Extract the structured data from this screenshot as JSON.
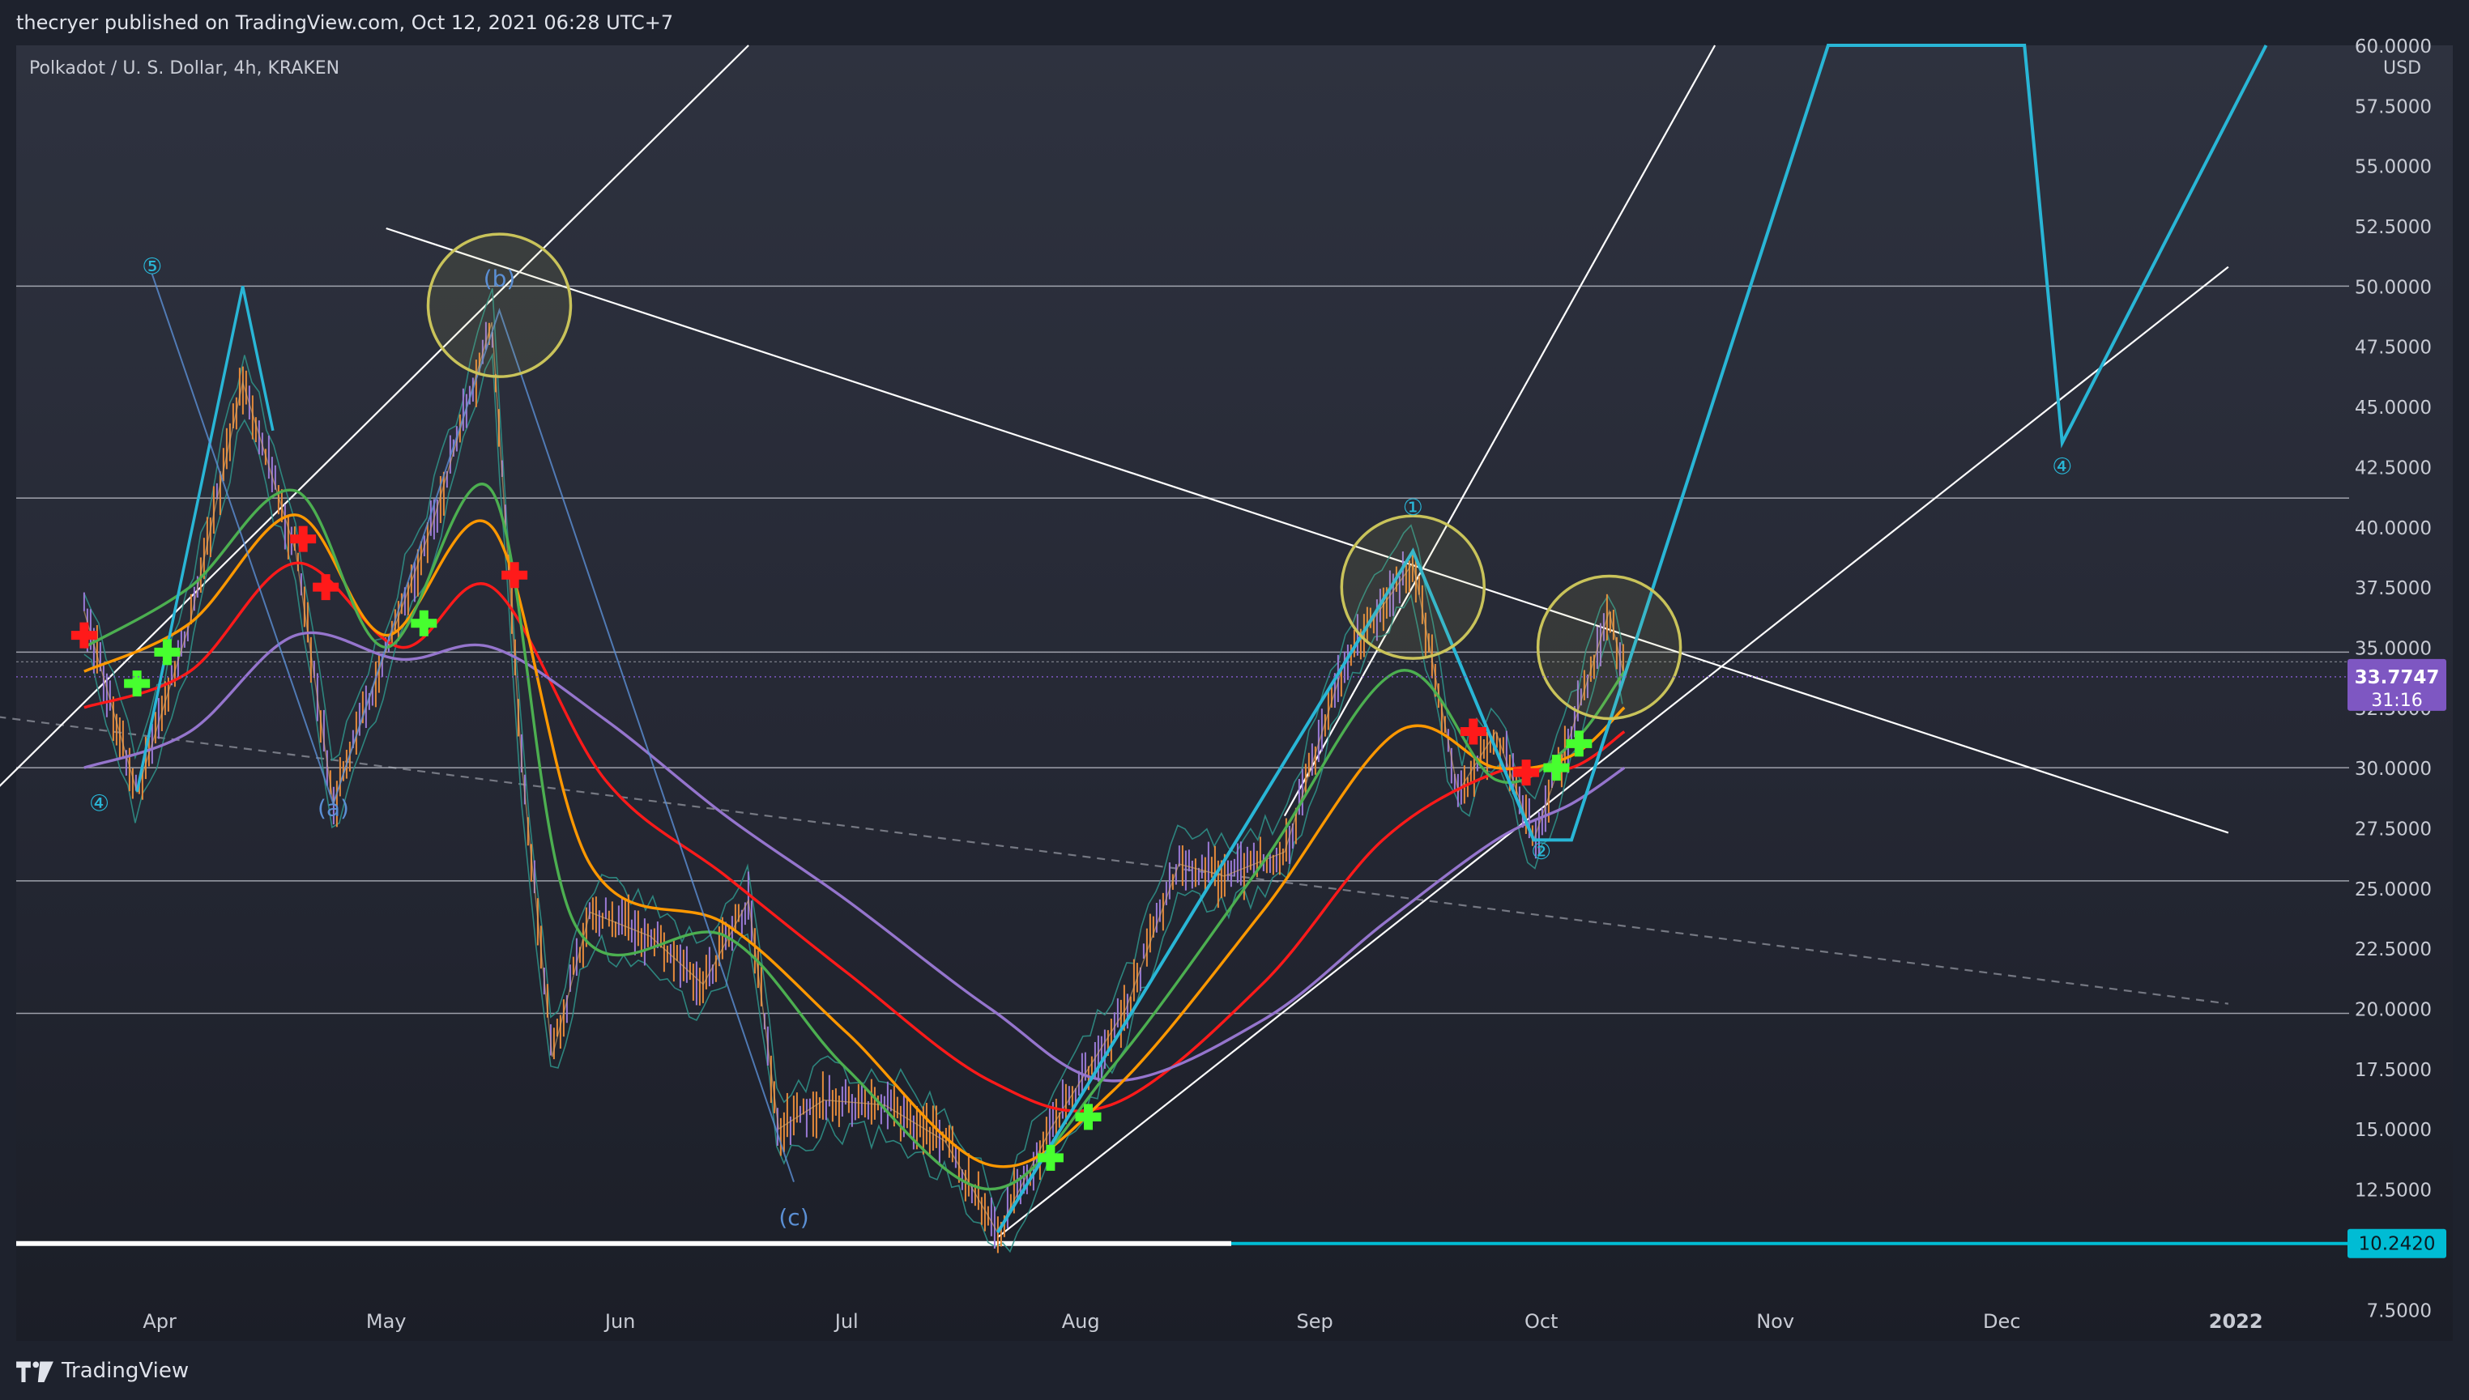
{
  "header": {
    "published": "thecryer published on TradingView.com, Oct 12, 2021 06:28 UTC+7"
  },
  "footer": {
    "brand": "TradingView",
    "logo_icon": "tradingview-logo-icon"
  },
  "colors": {
    "grid": "#c8cbd4",
    "ema_red": "#ff1a1a",
    "ema_orange": "#ff9800",
    "ema_green": "#4caf50",
    "ema_purple": "#9575cd",
    "wave_cyan": "#29b6d6",
    "circle_yellow": "#c9c35a",
    "cross_green": "#47ff2f",
    "cross_red": "#ff1a1a",
    "price_tag": "#7e57c2",
    "support_tag": "#00bcd4"
  },
  "chart_data": {
    "type": "line",
    "title": "Polkadot / U. S. Dollar, 4h, KRAKEN",
    "currency": "USD",
    "x_ticks": [
      "Apr",
      "May",
      "Jun",
      "Jul",
      "Aug",
      "Sep",
      "Oct",
      "Nov",
      "Dec",
      "2022"
    ],
    "y_ticks": [
      "60.0000",
      "57.5000",
      "55.0000",
      "52.5000",
      "50.0000",
      "47.5000",
      "45.0000",
      "42.5000",
      "40.0000",
      "37.5000",
      "35.0000",
      "32.5000",
      "30.0000",
      "27.5000",
      "25.0000",
      "22.5000",
      "20.0000",
      "17.5000",
      "15.0000",
      "12.5000",
      "7.5000"
    ],
    "ylim": [
      6.4,
      60.0
    ],
    "xlim_days_label": "Mar 2021 – Jan 2022",
    "last_price": {
      "value": "33.7747",
      "countdown": "31:16"
    },
    "support_level": {
      "value": "10.2420"
    },
    "horizontal_levels": [
      50.0,
      41.2,
      34.8,
      30.0,
      25.3,
      19.8
    ],
    "price_path": [
      {
        "x": "2021-03-22",
        "y": 36.5
      },
      {
        "x": "2021-03-29",
        "y": 29.0
      },
      {
        "x": "2021-04-05",
        "y": 36.0
      },
      {
        "x": "2021-04-12",
        "y": 46.0
      },
      {
        "x": "2021-04-19",
        "y": 39.0
      },
      {
        "x": "2021-04-24",
        "y": 28.5
      },
      {
        "x": "2021-04-30",
        "y": 34.0
      },
      {
        "x": "2021-05-07",
        "y": 40.0
      },
      {
        "x": "2021-05-15",
        "y": 48.5
      },
      {
        "x": "2021-05-19",
        "y": 30.0
      },
      {
        "x": "2021-05-23",
        "y": 18.0
      },
      {
        "x": "2021-05-28",
        "y": 24.0
      },
      {
        "x": "2021-06-05",
        "y": 23.0
      },
      {
        "x": "2021-06-12",
        "y": 21.0
      },
      {
        "x": "2021-06-18",
        "y": 24.5
      },
      {
        "x": "2021-06-22",
        "y": 15.0
      },
      {
        "x": "2021-06-28",
        "y": 16.2
      },
      {
        "x": "2021-07-06",
        "y": 16.0
      },
      {
        "x": "2021-07-14",
        "y": 14.5
      },
      {
        "x": "2021-07-21",
        "y": 10.7
      },
      {
        "x": "2021-07-28",
        "y": 15.0
      },
      {
        "x": "2021-08-07",
        "y": 20.0
      },
      {
        "x": "2021-08-14",
        "y": 26.0
      },
      {
        "x": "2021-08-20",
        "y": 25.5
      },
      {
        "x": "2021-08-28",
        "y": 26.5
      },
      {
        "x": "2021-09-05",
        "y": 34.5
      },
      {
        "x": "2021-09-14",
        "y": 38.5
      },
      {
        "x": "2021-09-20",
        "y": 29.0
      },
      {
        "x": "2021-09-25",
        "y": 31.5
      },
      {
        "x": "2021-09-30",
        "y": 27.0
      },
      {
        "x": "2021-10-05",
        "y": 31.5
      },
      {
        "x": "2021-10-10",
        "y": 36.5
      },
      {
        "x": "2021-10-12",
        "y": 33.7747
      }
    ],
    "series": [
      {
        "color_key": "ema_red",
        "values": [
          {
            "x": "2021-03-22",
            "y": 32.5
          },
          {
            "x": "2021-04-05",
            "y": 34.0
          },
          {
            "x": "2021-04-19",
            "y": 38.5
          },
          {
            "x": "2021-05-03",
            "y": 35.0
          },
          {
            "x": "2021-05-15",
            "y": 37.5
          },
          {
            "x": "2021-05-30",
            "y": 29.5
          },
          {
            "x": "2021-06-15",
            "y": 25.5
          },
          {
            "x": "2021-07-01",
            "y": 21.5
          },
          {
            "x": "2021-07-20",
            "y": 17.0
          },
          {
            "x": "2021-08-05",
            "y": 16.0
          },
          {
            "x": "2021-08-25",
            "y": 21.0
          },
          {
            "x": "2021-09-10",
            "y": 27.0
          },
          {
            "x": "2021-09-25",
            "y": 29.8
          },
          {
            "x": "2021-10-05",
            "y": 30.0
          },
          {
            "x": "2021-10-12",
            "y": 31.5
          }
        ]
      },
      {
        "color_key": "ema_purple",
        "values": [
          {
            "x": "2021-03-22",
            "y": 30.0
          },
          {
            "x": "2021-04-05",
            "y": 31.5
          },
          {
            "x": "2021-04-19",
            "y": 35.5
          },
          {
            "x": "2021-05-03",
            "y": 34.5
          },
          {
            "x": "2021-05-15",
            "y": 35.0
          },
          {
            "x": "2021-05-30",
            "y": 32.0
          },
          {
            "x": "2021-06-15",
            "y": 28.0
          },
          {
            "x": "2021-07-01",
            "y": 24.5
          },
          {
            "x": "2021-07-20",
            "y": 20.0
          },
          {
            "x": "2021-08-05",
            "y": 17.0
          },
          {
            "x": "2021-08-25",
            "y": 19.5
          },
          {
            "x": "2021-09-10",
            "y": 23.5
          },
          {
            "x": "2021-09-25",
            "y": 27.0
          },
          {
            "x": "2021-10-05",
            "y": 28.5
          },
          {
            "x": "2021-10-12",
            "y": 30.0
          }
        ]
      },
      {
        "color_key": "ema_orange",
        "values": [
          {
            "x": "2021-03-22",
            "y": 34.0
          },
          {
            "x": "2021-04-05",
            "y": 36.0
          },
          {
            "x": "2021-04-19",
            "y": 40.5
          },
          {
            "x": "2021-05-01",
            "y": 35.5
          },
          {
            "x": "2021-05-15",
            "y": 40.0
          },
          {
            "x": "2021-05-28",
            "y": 26.0
          },
          {
            "x": "2021-06-15",
            "y": 23.5
          },
          {
            "x": "2021-07-01",
            "y": 19.0
          },
          {
            "x": "2021-07-20",
            "y": 13.5
          },
          {
            "x": "2021-08-05",
            "y": 16.5
          },
          {
            "x": "2021-08-25",
            "y": 24.0
          },
          {
            "x": "2021-09-12",
            "y": 31.5
          },
          {
            "x": "2021-09-25",
            "y": 30.0
          },
          {
            "x": "2021-10-05",
            "y": 30.5
          },
          {
            "x": "2021-10-12",
            "y": 32.5
          }
        ]
      },
      {
        "color_key": "ema_green",
        "values": [
          {
            "x": "2021-03-22",
            "y": 35.0
          },
          {
            "x": "2021-04-05",
            "y": 37.5
          },
          {
            "x": "2021-04-19",
            "y": 41.5
          },
          {
            "x": "2021-05-01",
            "y": 35.0
          },
          {
            "x": "2021-05-15",
            "y": 41.5
          },
          {
            "x": "2021-05-26",
            "y": 23.5
          },
          {
            "x": "2021-06-15",
            "y": 23.0
          },
          {
            "x": "2021-07-01",
            "y": 17.5
          },
          {
            "x": "2021-07-20",
            "y": 12.5
          },
          {
            "x": "2021-08-05",
            "y": 17.5
          },
          {
            "x": "2021-08-25",
            "y": 26.0
          },
          {
            "x": "2021-09-12",
            "y": 34.0
          },
          {
            "x": "2021-09-25",
            "y": 29.5
          },
          {
            "x": "2021-10-05",
            "y": 31.0
          },
          {
            "x": "2021-10-12",
            "y": 34.0
          }
        ]
      }
    ],
    "wave_projection": [
      {
        "x": "2021-07-21",
        "y": 10.7
      },
      {
        "x": "2021-09-14",
        "y": 39.0
      },
      {
        "x": "2021-09-30",
        "y": 27.0
      },
      {
        "x": "2021-10-05",
        "y": 27.0
      },
      {
        "x": "2021-11-08",
        "y": 60.0
      },
      {
        "x": "2021-12-04",
        "y": 60.0
      },
      {
        "x": "2021-12-09",
        "y": 43.5
      },
      {
        "x": "2022-01-05",
        "y": 60.0
      }
    ],
    "wave_labels": [
      {
        "text": "⑤",
        "x": "2021-03-31",
        "y": 50.5
      },
      {
        "text": "④",
        "x": "2021-03-24",
        "y": 28.2
      },
      {
        "text": "(a)",
        "x": "2021-04-24",
        "y": 28.0
      },
      {
        "text": "(b)",
        "x": "2021-05-16",
        "y": 50.0
      },
      {
        "text": "(c)",
        "x": "2021-06-24",
        "y": 11.0
      },
      {
        "text": "①",
        "x": "2021-09-14",
        "y": 40.5
      },
      {
        "text": "②",
        "x": "2021-10-01",
        "y": 26.2
      },
      {
        "text": "④",
        "x": "2021-12-09",
        "y": 42.2
      }
    ],
    "trendlines": [
      {
        "from": {
          "x": "2021-05-01",
          "y": 52.4
        },
        "to": {
          "x": "2021-12-31",
          "y": 27.3
        },
        "style": "solid"
      },
      {
        "from": {
          "x": "2021-03-01",
          "y": 32.5
        },
        "to": {
          "x": "2021-12-31",
          "y": 20.2
        },
        "style": "dashed"
      },
      {
        "from": {
          "x": "2021-03-01",
          "y": 26.2
        },
        "to": {
          "x": "2021-06-18",
          "y": 60.0
        },
        "style": "solid"
      },
      {
        "from": {
          "x": "2021-07-21",
          "y": 10.5
        },
        "to": {
          "x": "2021-12-31",
          "y": 50.8
        },
        "style": "solid"
      },
      {
        "from": {
          "x": "2021-08-28",
          "y": 28.0
        },
        "to": {
          "x": "2021-10-24",
          "y": 60.0
        },
        "style": "solid"
      }
    ],
    "highlight_circles": [
      {
        "x": "2021-05-16",
        "y": 49.2
      },
      {
        "x": "2021-09-14",
        "y": 37.5
      },
      {
        "x": "2021-10-10",
        "y": 35.0
      }
    ],
    "signals": [
      {
        "type": "sell",
        "x": "2021-03-22",
        "y": 35.5
      },
      {
        "type": "sell",
        "x": "2021-04-20",
        "y": 39.5
      },
      {
        "type": "sell",
        "x": "2021-04-23",
        "y": 37.5
      },
      {
        "type": "sell",
        "x": "2021-05-18",
        "y": 38.0
      },
      {
        "type": "sell",
        "x": "2021-09-22",
        "y": 31.5
      },
      {
        "type": "sell",
        "x": "2021-09-29",
        "y": 29.8
      },
      {
        "type": "buy",
        "x": "2021-03-29",
        "y": 33.5
      },
      {
        "type": "buy",
        "x": "2021-04-02",
        "y": 34.8
      },
      {
        "type": "buy",
        "x": "2021-05-06",
        "y": 36.0
      },
      {
        "type": "buy",
        "x": "2021-07-28",
        "y": 13.8
      },
      {
        "type": "buy",
        "x": "2021-08-02",
        "y": 15.5
      },
      {
        "type": "buy",
        "x": "2021-10-03",
        "y": 30.0
      },
      {
        "type": "buy",
        "x": "2021-10-06",
        "y": 31.0
      }
    ]
  }
}
